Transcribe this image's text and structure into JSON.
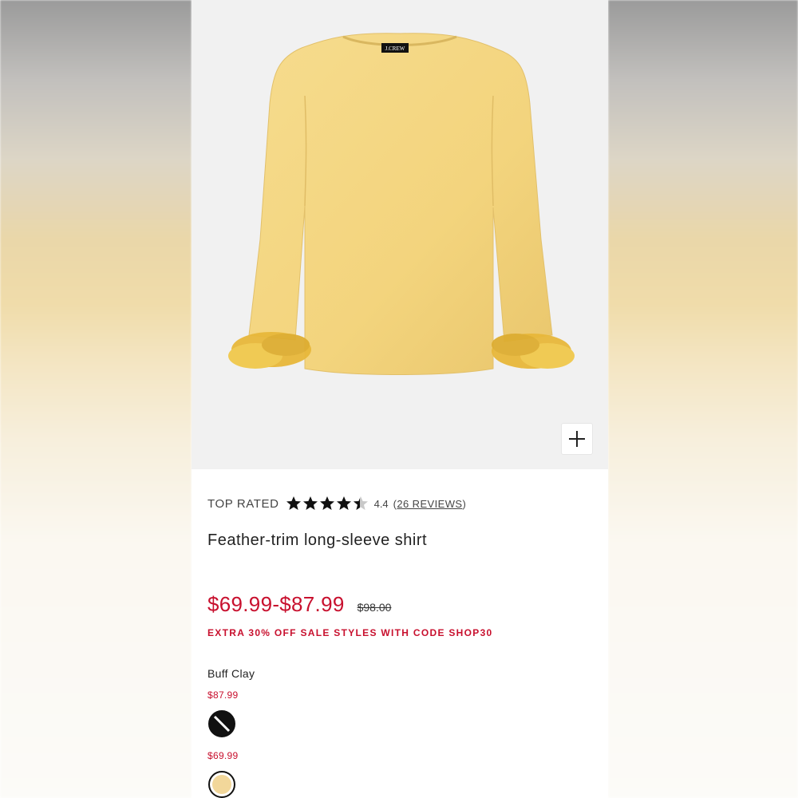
{
  "product": {
    "rating_label": "TOP RATED",
    "rating_value": "4.4",
    "rating_stars": 4.4,
    "reviews_open": "(",
    "reviews_text": "26 REVIEWS",
    "reviews_close": ")",
    "title": "Feather-trim long-sleeve shirt",
    "price_range": "$69.99-$87.99",
    "original_price": "$98.00",
    "promo": "EXTRA 30% OFF SALE STYLES WITH CODE SHOP30",
    "color_name": "Buff Clay",
    "brand_tag": "J.CREW"
  },
  "swatches": [
    {
      "price": "$87.99",
      "state": "unavailable"
    },
    {
      "price": "$69.99",
      "state": "selected"
    }
  ],
  "icons": {
    "zoom": "plus-icon",
    "star": "star-icon"
  },
  "colors": {
    "sale_red": "#c8102e",
    "shirt_yellow": "#f3d683",
    "feather": "#e8b83a"
  }
}
